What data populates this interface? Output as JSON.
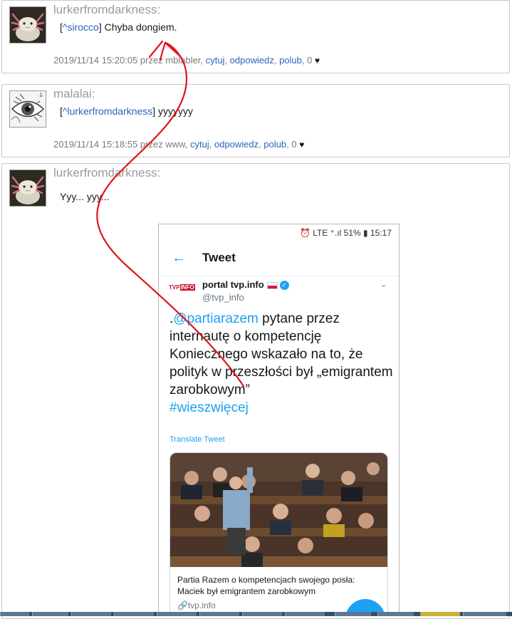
{
  "posts": [
    {
      "author": "lurkerfromdarkness:",
      "quote_open": "[",
      "quote_link": "^sirocco",
      "quote_close": "]",
      "text": " Chyba dongiem.",
      "meta_prefix": "2019/11/14 15:20:05 przez mblabler,",
      "actions": [
        "cytuj",
        "odpowiedz",
        "polub"
      ],
      "likes": "0"
    },
    {
      "author": "malalai:",
      "quote_open": "[",
      "quote_link": "^lurkerfromdarkness",
      "quote_close": "]",
      "text": " yyyyyyy",
      "meta_prefix": "2019/11/14 15:18:55 przez www,",
      "actions": [
        "cytuj",
        "odpowiedz",
        "polub"
      ],
      "likes": "0"
    },
    {
      "author": "lurkerfromdarkness:",
      "text": "Yyy... yyy..."
    }
  ],
  "phone": {
    "status": "⏰ LTE ⁺.ıl 51% ▮ 15:17",
    "header_title": "Tweet",
    "account_name": "portal tvp.info",
    "account_handle": "@tvp_info",
    "logo_text_tvp": "TVP",
    "logo_text_info": "INFO",
    "tweet_prefix": ".",
    "tweet_mention": "@partiarazem",
    "tweet_body": " pytane przez internautę o kompetencję Koniecznego wskazało na to, że polityk w przeszłości był „emigrantem zarobkowym”",
    "tweet_hashtag": "#wieszwięcej",
    "translate_label": "Translate Tweet",
    "card_title": "Partia Razem o kompetencjach swojego posła: Maciek był emigrantem zarobkowym",
    "card_domain": "tvp.info"
  },
  "icons": {
    "back": "arrow-left-icon",
    "verified": "verified-badge-icon",
    "link": "link-icon",
    "heart": "heart-icon"
  },
  "colors": {
    "link": "#2a64c0",
    "twitter_blue": "#1da1f2",
    "annotation": "#e0141e"
  }
}
